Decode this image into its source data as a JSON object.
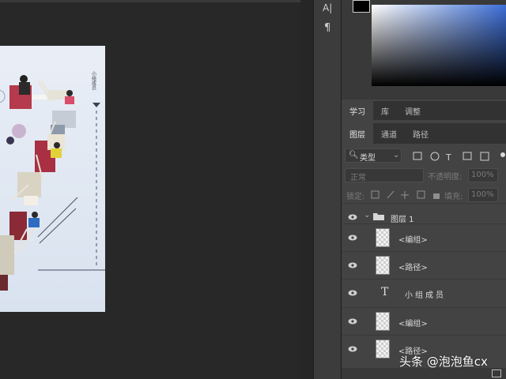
{
  "tools": {
    "char_icon": "A|",
    "para_icon": "¶"
  },
  "tab_group1": [
    "学习",
    "库",
    "调整"
  ],
  "tab_group2": [
    "图层",
    "通道",
    "路径"
  ],
  "filter": {
    "label": "类型"
  },
  "blend": {
    "mode": "正常",
    "opacity_label": "不透明度:",
    "opacity_value": "100%"
  },
  "lock": {
    "label": "锁定:",
    "fill_label": "填充:",
    "fill_value": "100%"
  },
  "layers": [
    {
      "name": "图层 1",
      "kind": "group"
    },
    {
      "name": "<编组>",
      "kind": "thumb"
    },
    {
      "name": "<路径>",
      "kind": "thumb"
    },
    {
      "name": "小组成员",
      "kind": "text"
    },
    {
      "name": "<编组>",
      "kind": "thumb"
    },
    {
      "name": "<路径>",
      "kind": "thumb"
    }
  ],
  "canvas": {
    "vertical_text": "小组成员"
  },
  "watermark": "头条 @泡泡鱼cx",
  "colors": {
    "accent": "#3d6fd8",
    "panel": "#434343",
    "canvas_bg": "#282828"
  }
}
